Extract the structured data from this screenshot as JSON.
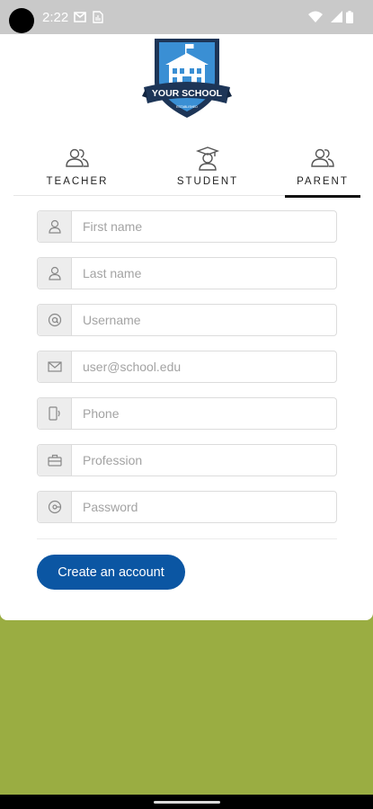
{
  "status_bar": {
    "time": "2:22",
    "icons": [
      "gmail-icon",
      "sim-icon",
      "wifi-icon",
      "signal-icon",
      "battery-icon"
    ]
  },
  "logo": {
    "text": "YOUR SCHOOL",
    "subtext": "ESTABLISHED",
    "colors": {
      "navy": "#1d3557",
      "blue": "#3a8fd4",
      "white": "#ffffff"
    }
  },
  "tabs": [
    {
      "label": "TEACHER",
      "icon": "users-icon",
      "active": false
    },
    {
      "label": "STUDENT",
      "icon": "graduate-icon",
      "active": false
    },
    {
      "label": "PARENT",
      "icon": "users-icon",
      "active": true
    }
  ],
  "form": {
    "fields": [
      {
        "name": "first-name",
        "placeholder": "First name",
        "icon": "user-icon",
        "value": ""
      },
      {
        "name": "last-name",
        "placeholder": "Last name",
        "icon": "user-icon",
        "value": ""
      },
      {
        "name": "username",
        "placeholder": "Username",
        "icon": "at-icon",
        "value": ""
      },
      {
        "name": "email",
        "placeholder": "user@school.edu",
        "icon": "mail-icon",
        "value": ""
      },
      {
        "name": "phone",
        "placeholder": "Phone",
        "icon": "phone-icon",
        "value": ""
      },
      {
        "name": "profession",
        "placeholder": "Profession",
        "icon": "briefcase-icon",
        "value": ""
      },
      {
        "name": "password",
        "placeholder": "Password",
        "icon": "key-icon",
        "value": ""
      }
    ],
    "submit_label": "Create an account"
  },
  "colors": {
    "primary": "#0b56a3",
    "background": "#9aad42",
    "card": "#ffffff"
  }
}
